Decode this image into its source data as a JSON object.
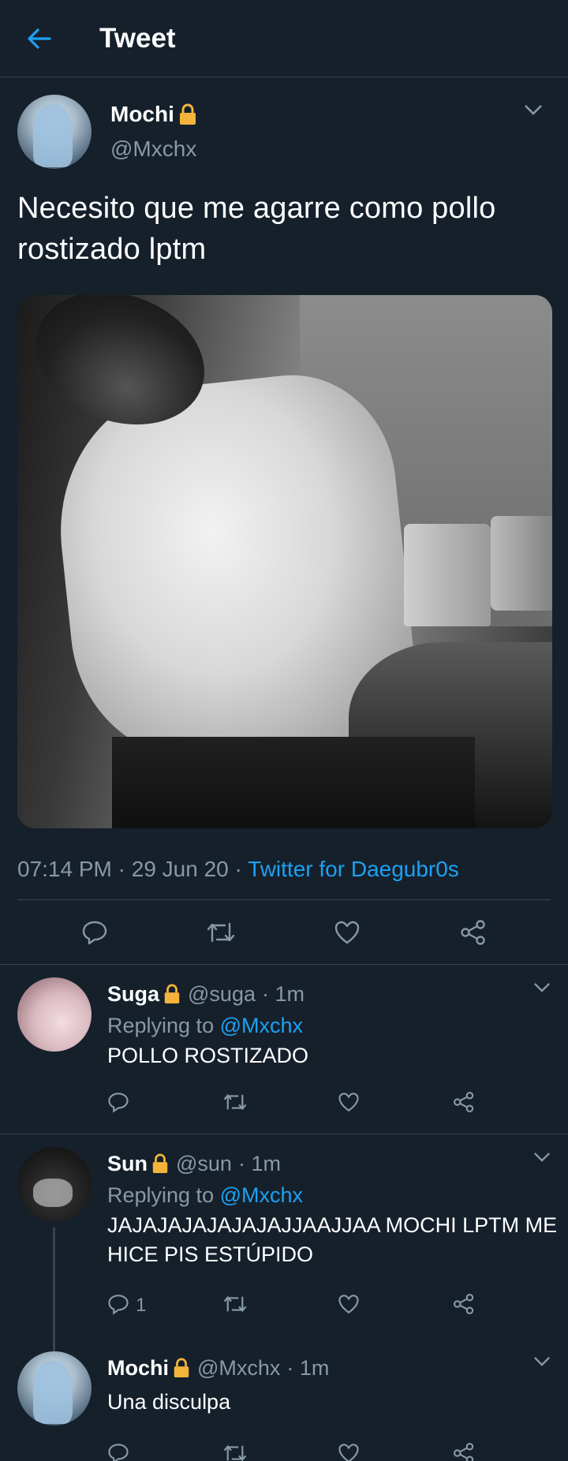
{
  "header": {
    "title": "Tweet",
    "back_icon": "arrow-left-icon"
  },
  "colors": {
    "background": "#15202b",
    "accent": "#1da1f2",
    "muted": "#8899a6",
    "divider": "#38444d"
  },
  "main_tweet": {
    "display_name": "Mochi",
    "handle": "@Mxchx",
    "text": "Necesito que me agarre como pollo rostizado lptm",
    "time": "07:14 PM",
    "date": "29 Jun 20",
    "source": "Twitter for Daegubr0s",
    "separator": "·"
  },
  "replies": [
    {
      "display_name": "Suga",
      "handle": "@suga",
      "time": "· 1m",
      "replying_label": "Replying to",
      "replying_to": "@Mxchx",
      "text": "POLLO ROSTIZADO",
      "reply_count": ""
    },
    {
      "display_name": "Sun",
      "handle": "@sun",
      "time": "· 1m",
      "replying_label": "Replying to",
      "replying_to": "@Mxchx",
      "text": "JAJAJAJAJAJAJAJJAAJJAA MOCHI LPTM ME HICE PIS ESTÚPIDO",
      "reply_count": "1"
    },
    {
      "display_name": "Mochi",
      "handle": "@Mxchx",
      "time": "· 1m",
      "text": "Una disculpa",
      "reply_count": ""
    }
  ]
}
